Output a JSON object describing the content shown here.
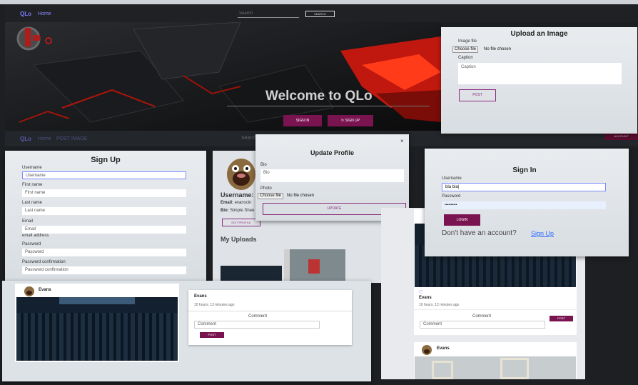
{
  "navbar": {
    "brand": "QLo",
    "home": "Home",
    "search_placeholder": "Search",
    "search_button": "SEARCH"
  },
  "hero": {
    "title": "Welcome to QLo",
    "sign_in": "SIGN IN",
    "sign_up": "SIGN UP"
  },
  "nav2": {
    "brand": "QLo",
    "home": "Home",
    "post": "POST IMAGE",
    "search_placeholder": "Search",
    "account": "ACCOUNT"
  },
  "upload": {
    "title": "Upload an Image",
    "image_label": "Image file",
    "choose": "Choose file",
    "no_file": "No file chosen",
    "caption_label": "Caption",
    "caption_placeholder": "Caption",
    "post": "POST"
  },
  "signup": {
    "title": "Sign Up",
    "username_label": "Username",
    "username_ph": "Username",
    "first_label": "First name",
    "first_ph": "First name",
    "last_label": "Last name",
    "last_ph": "Last name",
    "email_label": "Email",
    "email_ph": "Email",
    "email_help": "email address",
    "password_label": "Password",
    "password_ph": "Password",
    "confirm_label": "Password confirmation",
    "confirm_ph": "Password confirmation"
  },
  "profile": {
    "username_label": "Username:",
    "email_label": "Email:",
    "email_value": "evanscin",
    "bio_label": "Bio:",
    "bio_value": "Simple Shee",
    "edit_button": "EDIT PROFILE",
    "uploads_title": "My Uploads"
  },
  "update": {
    "close": "×",
    "title": "Update Profile",
    "bio_label": "Bio",
    "bio_value": "Bio",
    "photo_label": "Photo",
    "choose": "Choose file",
    "no_file": "No file chosen",
    "update_button": "UPDATE"
  },
  "signin": {
    "title": "Sign In",
    "username_label": "Username",
    "username_value": "bla bla|",
    "password_label": "Password",
    "password_value": "••••••••••",
    "login": "LOGIN",
    "no_account": "Don't have an account?",
    "signup_link": "Sign Up"
  },
  "post_modal": {
    "author": "Evans",
    "side_author": "Evans",
    "time": "10 hours, 13 minutes ago",
    "comment_title": "Comment",
    "comment_ph": "Comment",
    "post": "POST"
  },
  "feed": {
    "author": "Evans",
    "time": "10 hours, 12 minutes ago",
    "comment_title": "Comment",
    "comment_ph": "Comment",
    "post": "POST",
    "author2": "Evans"
  }
}
